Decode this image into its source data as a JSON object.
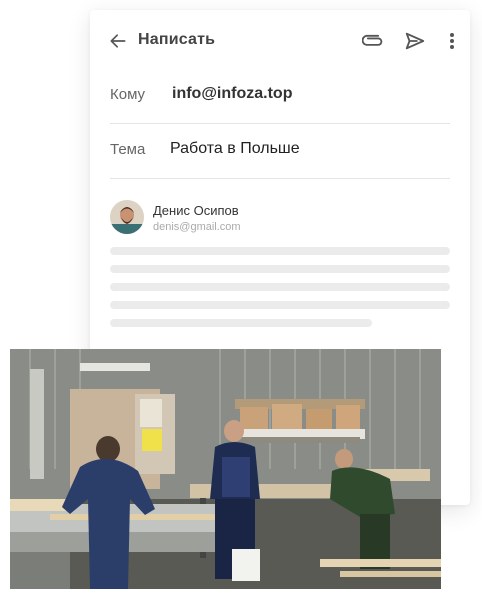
{
  "toolbar": {
    "title": "Написать",
    "icons": [
      "back-arrow-icon",
      "paperclip-icon",
      "send-icon",
      "more-vertical-icon"
    ]
  },
  "fields": {
    "to_label": "Кому",
    "to_value": "info@infoza.top",
    "subject_label": "Тема",
    "subject_value": "Работа в Польше"
  },
  "sender": {
    "name": "Денис Осипов",
    "email": "denis@gmail.com"
  },
  "colors": {
    "text_primary": "#333333",
    "text_muted": "#aaaaaa",
    "skeleton": "#ebebeb",
    "divider": "#e6e6e6"
  }
}
